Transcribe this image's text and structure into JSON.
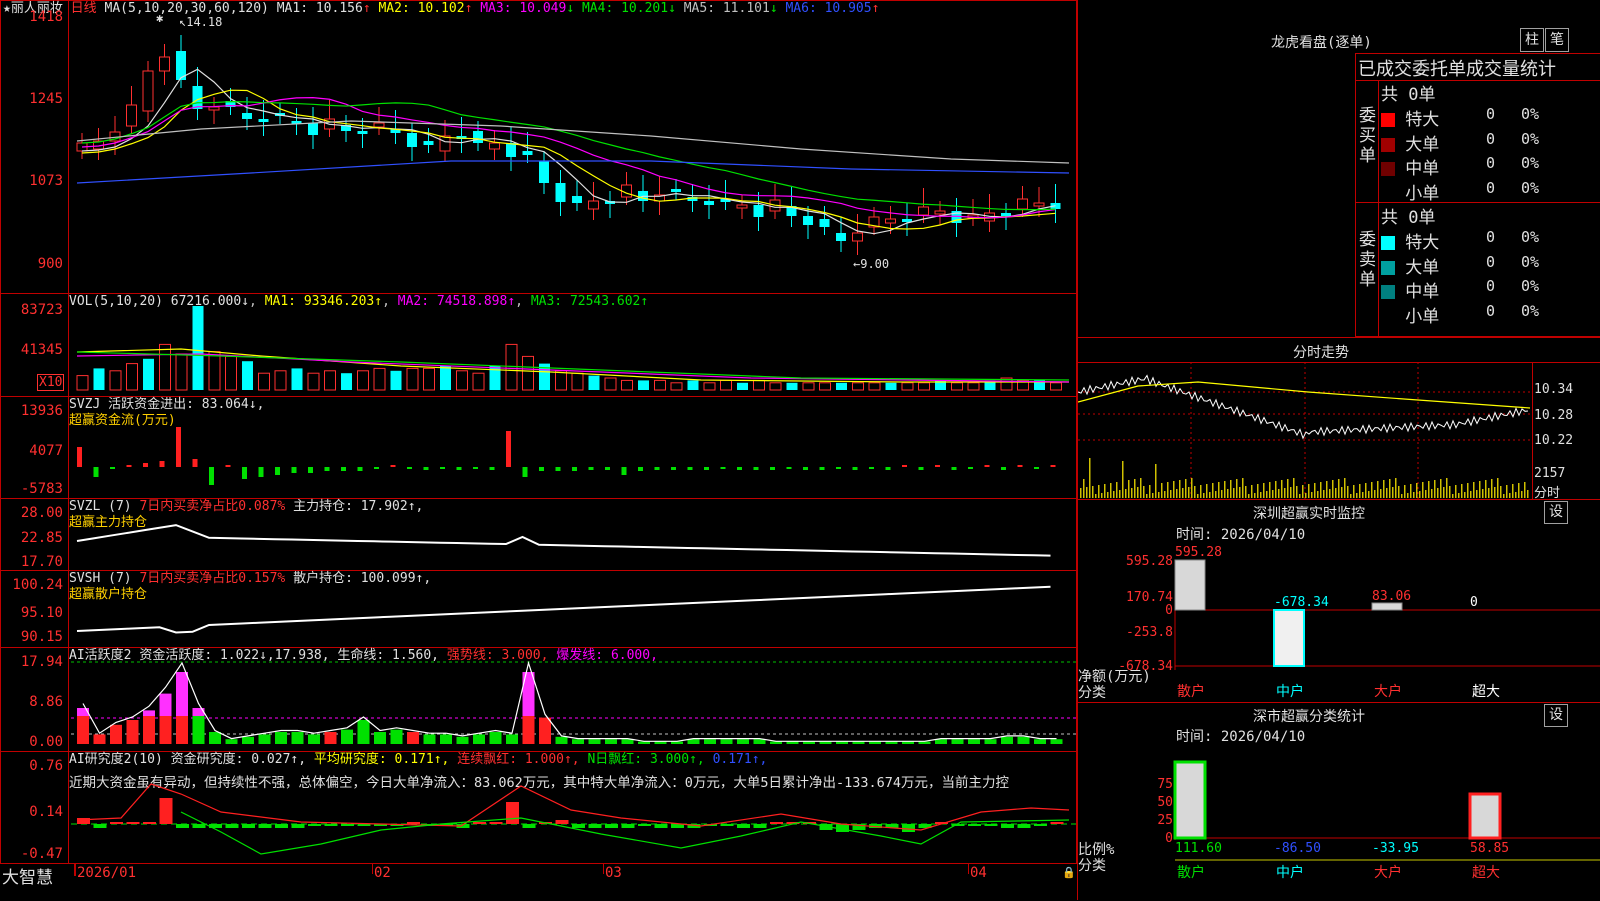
{
  "stock": {
    "name": "丽人丽妆",
    "period": "日线"
  },
  "main": {
    "ma_label": "MA(5,10,20,30,60,120)",
    "ma": [
      {
        "name": "MA1",
        "value": "10.156",
        "dir": "↑",
        "color": "#e0e0e0"
      },
      {
        "name": "MA2",
        "value": "10.102",
        "dir": "↑",
        "color": "#ffff00"
      },
      {
        "name": "MA3",
        "value": "10.049",
        "dir": "↓",
        "color": "#ff00ff"
      },
      {
        "name": "MA4",
        "value": "10.201",
        "dir": "↓",
        "color": "#00e000"
      },
      {
        "name": "MA5",
        "value": "11.101",
        "dir": "↓",
        "color": "#c0c0c0"
      },
      {
        "name": "MA6",
        "value": "10.905",
        "dir": "↑",
        "color": "#3050ff"
      }
    ],
    "yticks": [
      "1418",
      "1245",
      "1073",
      "900"
    ],
    "high_mark": "14.18",
    "low_mark": "←9.00",
    "star": "✱"
  },
  "vol": {
    "label": "VOL(5,10,20)",
    "value": "67216.000↓",
    "ma1": "MA1: 93346.203↑",
    "ma2": "MA2: 74518.898↑",
    "ma3": "MA3: 72543.602↑",
    "yticks": [
      "83723",
      "41345"
    ],
    "unit": "X10"
  },
  "svzj": {
    "label": "SVZJ",
    "text": "活跃资金进出: 83.064↓,",
    "sub": "超赢资金流(万元)",
    "yticks": [
      "13936",
      "4077",
      "-5783"
    ]
  },
  "svzl": {
    "label": "SVZL (7)",
    "text1": "7日内买卖净占比0.087%",
    "text2": "主力持仓: 17.902↑,",
    "sub": "超赢主力持仓",
    "yticks": [
      "28.00",
      "22.85",
      "17.70"
    ]
  },
  "svsh": {
    "label": "SVSH (7)",
    "text1": "7日内买卖净占比0.157%",
    "text2": "散户持仓: 100.099↑,",
    "sub": "超赢散户持仓",
    "yticks": [
      "100.24",
      "95.10",
      "90.15"
    ]
  },
  "ai": {
    "label": "AI活跃度2",
    "t1": "资金活跃度: 1.022↓,",
    "t2": "17.938,",
    "t3": "生命线: 1.560,",
    "t4": "强势线: 3.000,",
    "t5": "爆发线: 6.000,",
    "yticks": [
      "17.94",
      "8.86",
      "0.00"
    ]
  },
  "air": {
    "label": "AI研究度2(10)",
    "t1": "资金研究度: 0.027↑,",
    "t2": "平均研究度: 0.171↑,",
    "t3": "连续飘红: 1.000↑,",
    "t4": "N日飘红: 3.000↑,",
    "t5": "0.171↑,",
    "yticks": [
      "0.76",
      "0.14",
      "-0.47"
    ],
    "commentary": "近期大资金虽有异动，但持续性不强，总体偏空，今日大单净流入：83.062万元，其中特大单净流入：0万元，大单5日累计净出-133.674万元，当前主力控"
  },
  "xaxis": {
    "labels": [
      "2026/01",
      "02",
      "03",
      "04"
    ],
    "brand": "大智慧"
  },
  "right": {
    "lhb_title": "龙虎看盘(逐单)",
    "btn_zhu": "柱",
    "btn_bi": "笔",
    "stats_title": "已成交委托单成交量统计",
    "buy": {
      "side": "委买单",
      "total": "共 0单",
      "rows": [
        {
          "label": "特大",
          "count": "0",
          "pct": "0%",
          "color": "#ff0000"
        },
        {
          "label": "大单",
          "count": "0",
          "pct": "0%",
          "color": "#a00000"
        },
        {
          "label": "中单",
          "count": "0",
          "pct": "0%",
          "color": "#700000"
        },
        {
          "label": "小单",
          "count": "0",
          "pct": "0%",
          "color": "#000000"
        }
      ]
    },
    "sell": {
      "side": "委卖单",
      "total": "共 0单",
      "rows": [
        {
          "label": "特大",
          "count": "0",
          "pct": "0%",
          "color": "#00ffff"
        },
        {
          "label": "大单",
          "count": "0",
          "pct": "0%",
          "color": "#00a0a0"
        },
        {
          "label": "中单",
          "count": "0",
          "pct": "0%",
          "color": "#008080"
        },
        {
          "label": "小单",
          "count": "0",
          "pct": "0%",
          "color": "#000000"
        }
      ]
    },
    "fs_title": "分时走势",
    "fs_prices": [
      "10.34",
      "10.28",
      "10.22"
    ],
    "fs_vol": "2157",
    "fs_unit": "分时",
    "sz_title": "深圳超赢实时监控",
    "sz_btn": "设",
    "sz_time": "时间: 2026/04/10",
    "sz_y": [
      "595.28",
      "170.74",
      "0",
      "-253.8",
      "-678.34"
    ],
    "sz_vals": [
      "595.28",
      "-678.34",
      "83.06",
      "0"
    ],
    "sz_unit": "净额(万元)",
    "sz_cat": "分类",
    "sz_x": [
      "散户",
      "中户",
      "大户",
      "超大"
    ],
    "cls_title": "深市超赢分类统计",
    "cls_btn": "设",
    "cls_time": "时间: 2026/04/10",
    "cls_y": [
      "75",
      "50",
      "25",
      "0"
    ],
    "cls_vals": [
      "111.60",
      "-86.50",
      "-33.95",
      "58.85"
    ],
    "cls_unit": "比例%",
    "cls_cat": "分类",
    "cls_x": [
      "散户",
      "中户",
      "大户",
      "超大"
    ]
  }
}
